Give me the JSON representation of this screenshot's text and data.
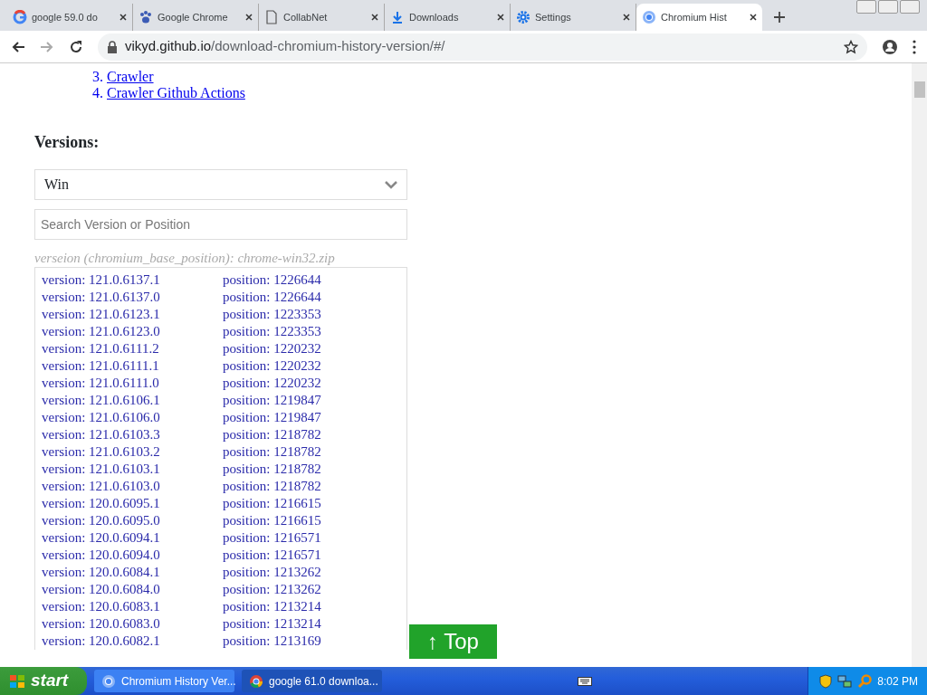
{
  "tabs": [
    {
      "title": "google 59.0 do",
      "selected": false
    },
    {
      "title": "Google Chrome",
      "selected": false
    },
    {
      "title": "CollabNet",
      "selected": false
    },
    {
      "title": "Downloads",
      "selected": false
    },
    {
      "title": "Settings",
      "selected": false
    },
    {
      "title": "Chromium Hist",
      "selected": true
    }
  ],
  "address": {
    "host": "vikyd.github.io",
    "path": "/download-chromium-history-version/#/"
  },
  "links": [
    {
      "number": "3.",
      "label": "Crawler"
    },
    {
      "number": "4.",
      "label": "Crawler Github Actions"
    }
  ],
  "heading": "Versions:",
  "platform_select": {
    "value": "Win"
  },
  "search": {
    "placeholder": "Search Version or Position"
  },
  "hint": "verseion (chromium_base_position): chrome-win32.zip",
  "versions": [
    {
      "version": "version: 121.0.6137.1",
      "position": "position: 1226644"
    },
    {
      "version": "version: 121.0.6137.0",
      "position": "position: 1226644"
    },
    {
      "version": "version: 121.0.6123.1",
      "position": "position: 1223353"
    },
    {
      "version": "version: 121.0.6123.0",
      "position": "position: 1223353"
    },
    {
      "version": "version: 121.0.6111.2",
      "position": "position: 1220232"
    },
    {
      "version": "version: 121.0.6111.1",
      "position": "position: 1220232"
    },
    {
      "version": "version: 121.0.6111.0",
      "position": "position: 1220232"
    },
    {
      "version": "version: 121.0.6106.1",
      "position": "position: 1219847"
    },
    {
      "version": "version: 121.0.6106.0",
      "position": "position: 1219847"
    },
    {
      "version": "version: 121.0.6103.3",
      "position": "position: 1218782"
    },
    {
      "version": "version: 121.0.6103.2",
      "position": "position: 1218782"
    },
    {
      "version": "version: 121.0.6103.1",
      "position": "position: 1218782"
    },
    {
      "version": "version: 121.0.6103.0",
      "position": "position: 1218782"
    },
    {
      "version": "version: 120.0.6095.1",
      "position": "position: 1216615"
    },
    {
      "version": "version: 120.0.6095.0",
      "position": "position: 1216615"
    },
    {
      "version": "version: 120.0.6094.1",
      "position": "position: 1216571"
    },
    {
      "version": "version: 120.0.6094.0",
      "position": "position: 1216571"
    },
    {
      "version": "version: 120.0.6084.1",
      "position": "position: 1213262"
    },
    {
      "version": "version: 120.0.6084.0",
      "position": "position: 1213262"
    },
    {
      "version": "version: 120.0.6083.1",
      "position": "position: 1213214"
    },
    {
      "version": "version: 120.0.6083.0",
      "position": "position: 1213214"
    },
    {
      "version": "version: 120.0.6082.1",
      "position": "position: 1213169"
    }
  ],
  "top_button": {
    "arrow": "↑",
    "label": "Top"
  },
  "taskbar": {
    "start": "start",
    "windows": [
      {
        "title": "Chromium History Ver...",
        "selected": false
      },
      {
        "title": "google 61.0 downloa...",
        "selected": true
      }
    ],
    "clock": "8:02 PM"
  }
}
